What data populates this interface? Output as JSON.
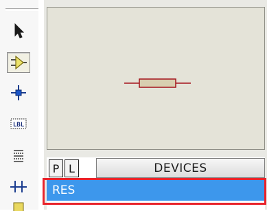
{
  "toolbar": {
    "tools": [
      {
        "name": "selection-mode",
        "icon": "arrow-cursor-icon",
        "active": false
      },
      {
        "name": "component-mode",
        "icon": "component-icon",
        "active": true
      },
      {
        "name": "junction-dot-mode",
        "icon": "junction-icon",
        "active": false
      },
      {
        "name": "wire-label-mode",
        "icon": "label-icon",
        "label_text": "LBL",
        "active": false
      },
      {
        "name": "text-script-mode",
        "icon": "text-script-icon",
        "active": false
      },
      {
        "name": "buses-mode",
        "icon": "bus-icon",
        "active": false
      },
      {
        "name": "subcircuit-mode",
        "icon": "subcircuit-icon",
        "active": false
      }
    ]
  },
  "preview": {
    "component": "resistor",
    "colors": {
      "background": "#e4e3d8",
      "lead": "#a3131b",
      "body_fill": "#d8cfb0",
      "body_stroke": "#a3131b"
    }
  },
  "picker": {
    "pick_label": "P",
    "library_label": "L",
    "header": "DEVICES",
    "items": [
      "RES"
    ],
    "selected_index": 0
  },
  "colors": {
    "selection": "#3d97ec",
    "highlight_annotation": "#e8232b"
  }
}
